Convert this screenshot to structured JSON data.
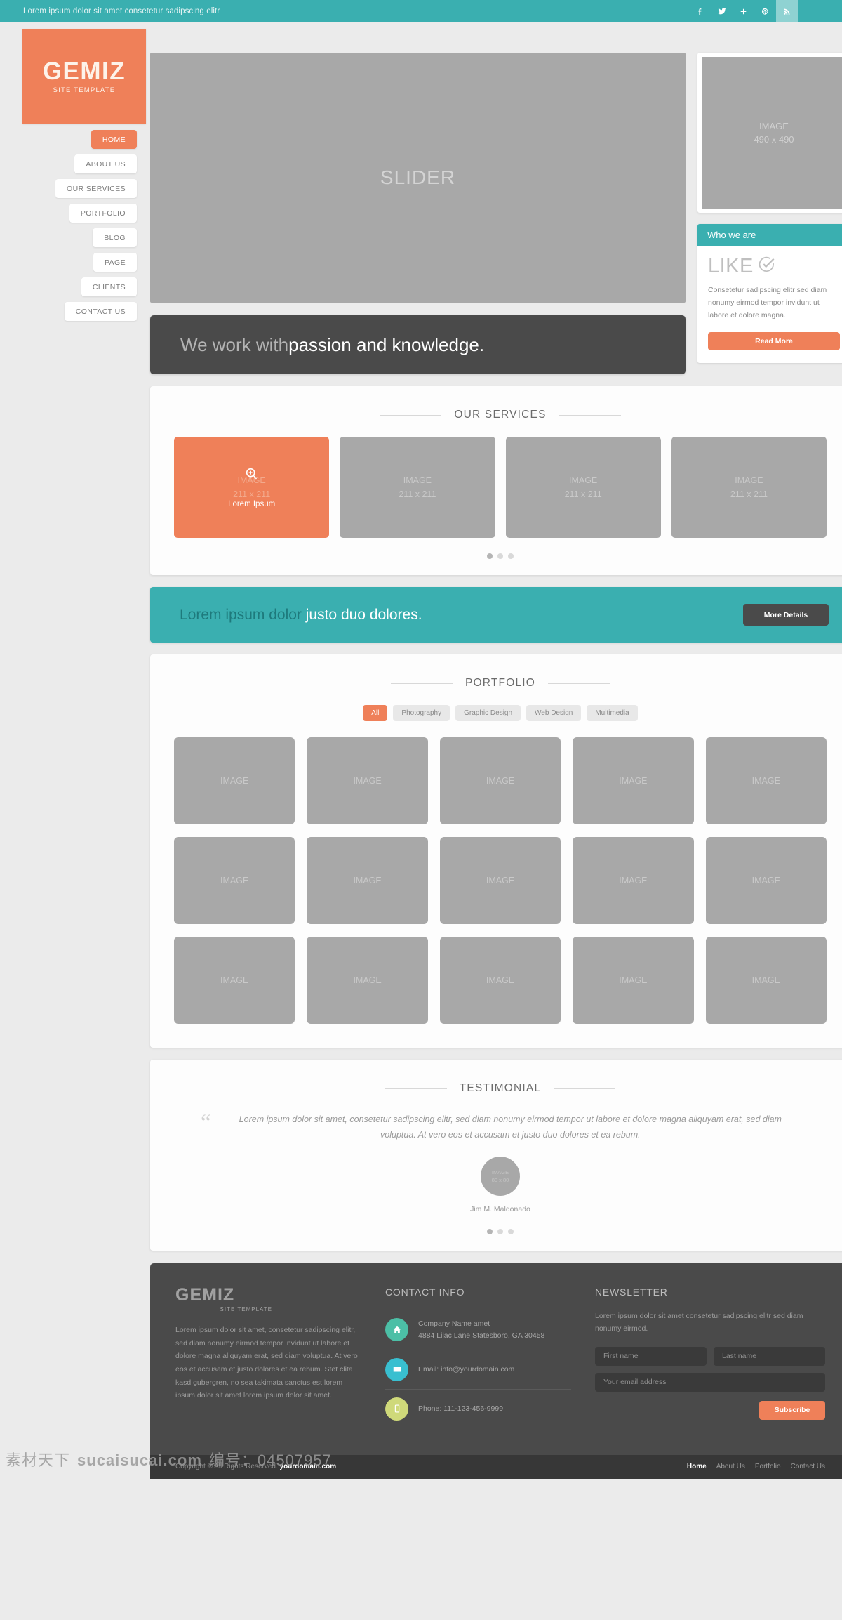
{
  "topbar": {
    "tagline": "Lorem ipsum dolor sit amet consetetur sadipscing elitr",
    "social": [
      {
        "name": "facebook-icon",
        "label": "f"
      },
      {
        "name": "twitter-icon",
        "label": "t"
      },
      {
        "name": "google-plus-icon",
        "label": "+"
      },
      {
        "name": "pinterest-icon",
        "label": "P"
      },
      {
        "name": "rss-icon",
        "label": "rss"
      }
    ]
  },
  "brand": {
    "title": "GEMIZ",
    "subtitle": "SITE TEMPLATE"
  },
  "nav": {
    "items": [
      {
        "label": "HOME"
      },
      {
        "label": "ABOUT US"
      },
      {
        "label": "OUR SERVICES"
      },
      {
        "label": "PORTFOLIO"
      },
      {
        "label": "BLOG"
      },
      {
        "label": "PAGE"
      },
      {
        "label": "CLIENTS"
      },
      {
        "label": "CONTACT US"
      }
    ]
  },
  "hero": {
    "slider_label": "SLIDER",
    "tagline_light": "We work with ",
    "tagline_bold": "passion and knowledge.",
    "image_panel": {
      "line1": "IMAGE",
      "line2": "490 x 490"
    },
    "whowe": {
      "heading": "Who we are",
      "like": "LIKE",
      "body": "Consetetur sadipscing elitr sed diam nonumy eirmod tempor invidunt ut labore et dolore magna.",
      "button": "Read More"
    }
  },
  "services": {
    "title": "OUR SERVICES",
    "items": [
      {
        "line1": "IMAGE",
        "line2": "211 x 211",
        "caption": "Lorem Ipsum",
        "active": true
      },
      {
        "line1": "IMAGE",
        "line2": "211 x 211",
        "caption": "",
        "active": false
      },
      {
        "line1": "IMAGE",
        "line2": "211 x 211",
        "caption": "",
        "active": false
      },
      {
        "line1": "IMAGE",
        "line2": "211 x 211",
        "caption": "",
        "active": false
      }
    ]
  },
  "cta": {
    "text_dark": "Lorem ipsum dolor ",
    "text_light": "justo duo dolores.",
    "button": "More Details"
  },
  "portfolio": {
    "title": "PORTFOLIO",
    "filters": [
      {
        "label": "All",
        "active": true
      },
      {
        "label": "Photography",
        "active": false
      },
      {
        "label": "Graphic Design",
        "active": false
      },
      {
        "label": "Web Design",
        "active": false
      },
      {
        "label": "Multimedia",
        "active": false
      }
    ],
    "cell_label": "IMAGE",
    "cell_count": 15
  },
  "testimonial": {
    "title": "TESTIMONIAL",
    "quote_mark": "“",
    "text": "Lorem ipsum dolor sit amet, consetetur sadipscing elitr, sed diam nonumy eirmod tempor ut labore et dolore magna aliquyam erat, sed diam voluptua. At vero eos et accusam et justo duo dolores et ea rebum.",
    "avatar": {
      "line1": "IMAGE",
      "line2": "80 x 80"
    },
    "author": "Jim M. Maldonado"
  },
  "footer": {
    "brand": {
      "title": "GEMIZ",
      "subtitle": "SITE TEMPLATE"
    },
    "about": "Lorem ipsum dolor sit amet, consetetur sadipscing elitr, sed diam nonumy eirmod tempor invidunt ut labore et dolore magna aliquyam erat, sed diam voluptua. At vero eos et accusam et justo dolores et ea rebum. Stet clita kasd gubergren, no sea takimata sanctus est lorem ipsum dolor sit amet lorem ipsum dolor sit amet.",
    "contact": {
      "heading": "CONTACT INFO",
      "address_line1": "Company Name amet",
      "address_line2": "4884 Lilac Lane Statesboro, GA 30458",
      "email": "Email: info@yourdomain.com",
      "phone": "Phone: 111-123-456-9999",
      "colors": {
        "home": "#4cbfa6",
        "mail": "#39bfd0",
        "phone": "#cfd97a"
      }
    },
    "newsletter": {
      "heading": "NEWSLETTER",
      "text": "Lorem ipsum dolor sit amet consetetur sadipscing elitr sed diam nonumy eirmod.",
      "first_name_placeholder": "First name",
      "last_name_placeholder": "Last name",
      "email_placeholder": "Your email address",
      "first_name_value": "",
      "last_name_value": "",
      "email_value": "",
      "button": "Subscribe"
    },
    "bottom": {
      "copyright_prefix": "Copyright © All Rights Reserved. ",
      "copyright_domain": "yourdomain.com",
      "links": [
        {
          "label": "Home",
          "active": true
        },
        {
          "label": "About Us",
          "active": false
        },
        {
          "label": "Portfolio",
          "active": false
        },
        {
          "label": "Contact Us",
          "active": false
        }
      ]
    }
  },
  "watermark": {
    "site_cn": "素材天下",
    "site": "sucaisucai.com",
    "code": "编号：04507957"
  },
  "colors": {
    "teal": "#3aafb0",
    "orange": "#ef8059",
    "dark": "#4a4a4a",
    "gray_placeholder": "#a8a8a8"
  }
}
